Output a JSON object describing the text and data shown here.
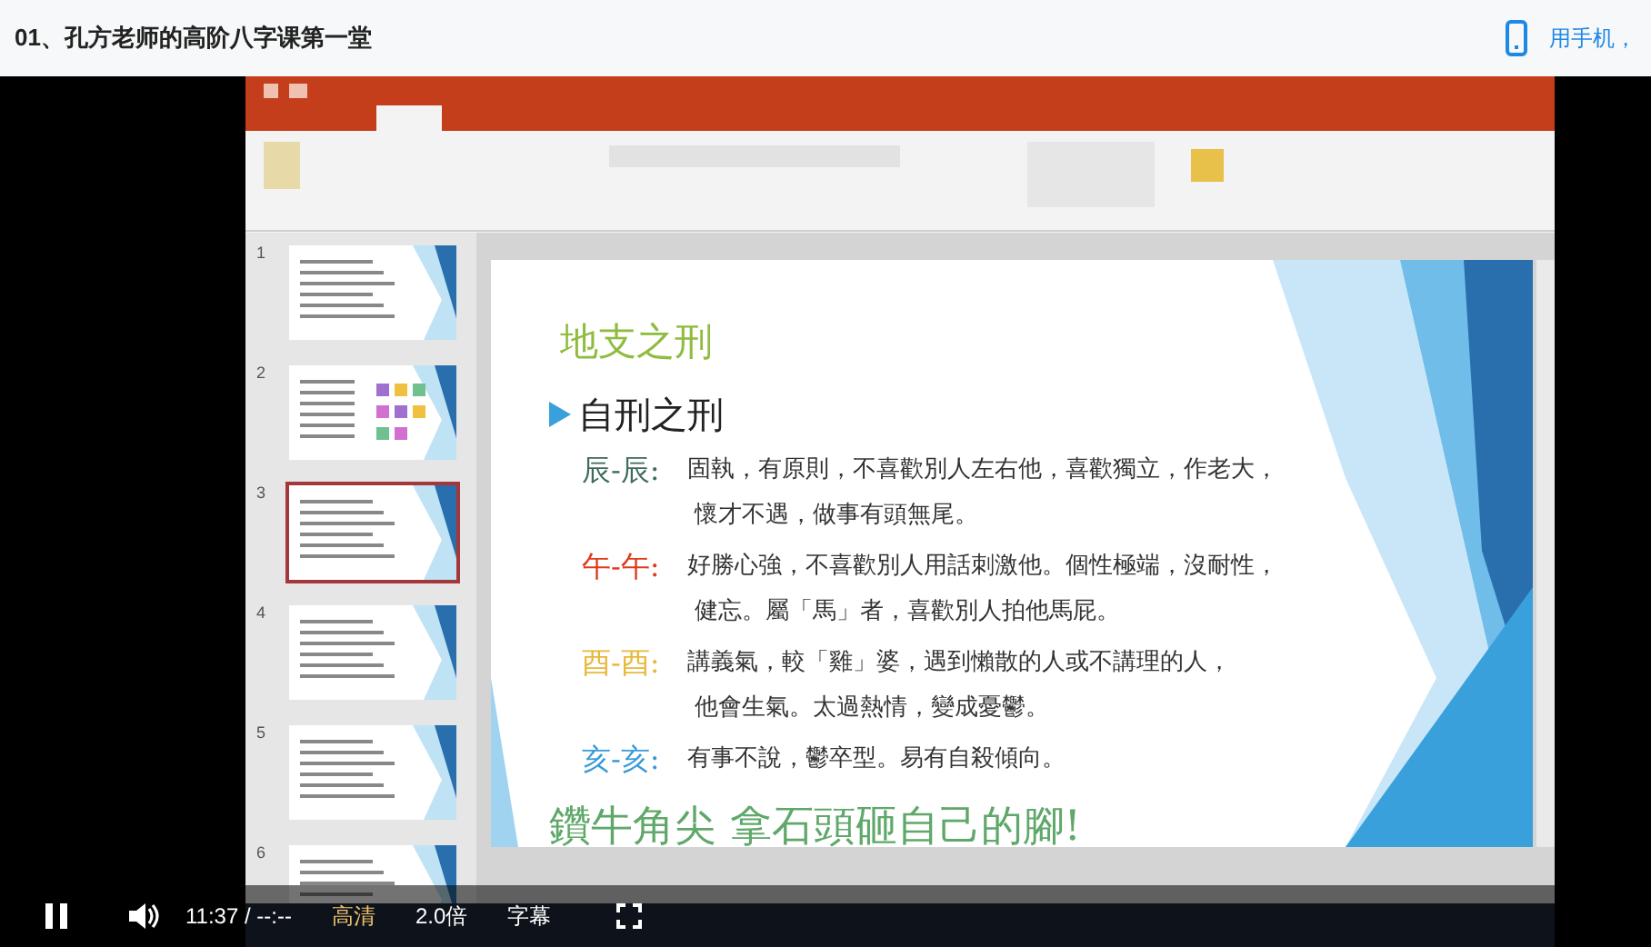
{
  "page": {
    "title": "01、孔方老师的高阶八字课第一堂",
    "mobile_link": "用手机，"
  },
  "slides_panel": [
    {
      "number": "1",
      "kind": "text",
      "selected": false
    },
    {
      "number": "2",
      "kind": "diagram",
      "selected": false
    },
    {
      "number": "3",
      "kind": "text",
      "selected": true
    },
    {
      "number": "4",
      "kind": "text",
      "selected": false
    },
    {
      "number": "5",
      "kind": "text",
      "selected": false
    },
    {
      "number": "6",
      "kind": "text",
      "selected": false
    }
  ],
  "slide": {
    "title": "地支之刑",
    "heading": "自刑之刑",
    "rows": [
      {
        "label": "辰-辰:",
        "color": "#3d6b5e",
        "lines": [
          "固執，有原則，不喜歡別人左右他，喜歡獨立，作老大，",
          "懷才不遇，做事有頭無尾。"
        ]
      },
      {
        "label": "午-午:",
        "color": "#e03a1a",
        "lines": [
          "好勝心強，不喜歡別人用話刺激他。個性極端，沒耐性，",
          "健忘。屬「馬」者，喜歡別人拍他馬屁。"
        ]
      },
      {
        "label": "酉-酉:",
        "color": "#e8b83a",
        "lines": [
          "講義氣，較「雞」婆，遇到懶散的人或不講理的人，",
          "他會生氣。太過熱情，變成憂鬱。"
        ]
      },
      {
        "label": "亥-亥:",
        "color": "#3a9ad9",
        "lines": [
          "有事不說，鬱卒型。易有自殺傾向。"
        ]
      }
    ],
    "slogan": "鑽牛角尖 拿石頭砸自己的腳!"
  },
  "player": {
    "time": "11:37 / --:--",
    "quality": "高清",
    "speed": "2.0倍",
    "subtitles": "字幕"
  }
}
